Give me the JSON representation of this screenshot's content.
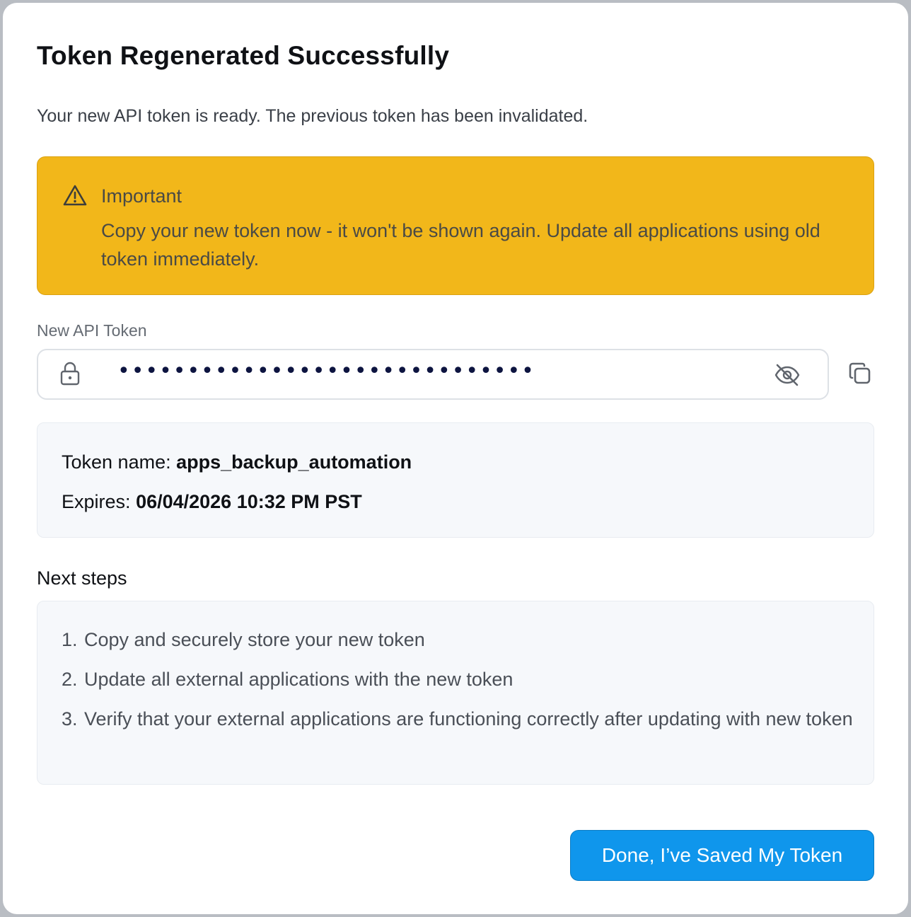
{
  "dialog": {
    "title": "Token Regenerated Successfully",
    "subtitle": "Your new API token is ready. The previous token has been invalidated."
  },
  "alert": {
    "icon": "warning-triangle-icon",
    "title": "Important",
    "body": "Copy your new token now - it won't be shown again. Update all applications using old token immediately.",
    "color": "#f2b71a"
  },
  "token_field": {
    "label": "New API Token",
    "masked_value": "••••••••••••••••••••••••••••••",
    "lock_icon": "lock-icon",
    "visibility_icon": "eye-off-icon",
    "copy_icon": "copy-icon"
  },
  "token_info": {
    "name_label": "Token name:",
    "name_value": "apps_backup_automation",
    "expires_label": "Expires:",
    "expires_value": "06/04/2026 10:32 PM PST"
  },
  "next_steps": {
    "title": "Next steps",
    "items": [
      {
        "num": "1.",
        "text": "Copy and securely store your new token"
      },
      {
        "num": "2.",
        "text": "Update all external applications with the new token"
      },
      {
        "num": "3.",
        "text": "Verify that your external applications are functioning correctly after updating with new token"
      }
    ]
  },
  "actions": {
    "done_label": "Done, I’ve Saved My Token",
    "accent": "#0f96ec"
  }
}
